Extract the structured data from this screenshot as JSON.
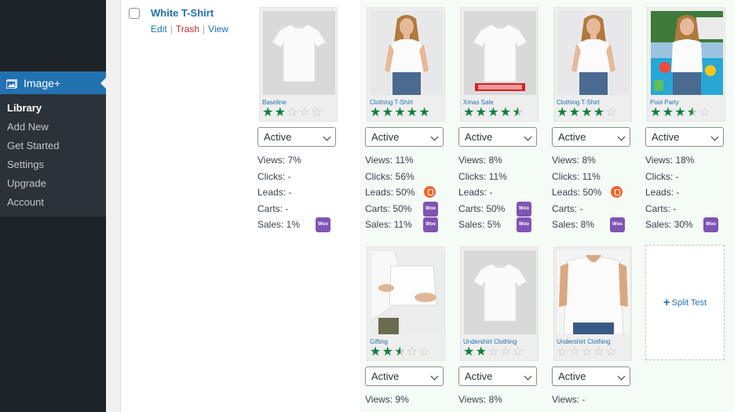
{
  "sidebar": {
    "plugin_label": "Image+",
    "items": [
      {
        "label": "Library",
        "current": true
      },
      {
        "label": "Add New",
        "current": false
      },
      {
        "label": "Get Started",
        "current": false
      },
      {
        "label": "Settings",
        "current": false
      },
      {
        "label": "Upgrade",
        "current": false
      },
      {
        "label": "Account",
        "current": false
      }
    ]
  },
  "product": {
    "title": "White T-Shirt",
    "actions": {
      "edit": "Edit",
      "trash": "Trash",
      "view": "View",
      "separator": "|"
    }
  },
  "select_option": "Active",
  "variants": [
    {
      "name": "Baseline",
      "image": "plain-tshirt",
      "rating": 2,
      "status": "Active",
      "stats": [
        "Views: 7%",
        "Clicks: -",
        "Leads: -",
        "Carts: -",
        "Sales: 1%"
      ],
      "badges": [
        "",
        "",
        "",
        "",
        "woo"
      ]
    },
    {
      "name": "Clothing T-Shirt",
      "image": "woman-model",
      "rating": 5,
      "status": "Active",
      "stats": [
        "Views: 11%",
        "Clicks: 56%",
        "Leads: 50%",
        "Carts: 50%",
        "Sales: 11%"
      ],
      "badges": [
        "",
        "",
        "convertkit",
        "woo",
        "woo"
      ]
    },
    {
      "name": "Xmas Sale",
      "image": "xmas-tshirt",
      "rating": 4.5,
      "status": "Active",
      "stats": [
        "Views: 8%",
        "Clicks: 11%",
        "Leads: -",
        "Carts: 50%",
        "Sales: 5%"
      ],
      "badges": [
        "",
        "",
        "",
        "woo",
        "woo"
      ]
    },
    {
      "name": "Clothing T-Shirt",
      "image": "woman-model",
      "rating": 4,
      "status": "Active",
      "stats": [
        "Views: 8%",
        "Clicks: 11%",
        "Leads: 50%",
        "Carts: -",
        "Sales: 8%"
      ],
      "badges": [
        "",
        "",
        "convertkit",
        "",
        "woo"
      ]
    },
    {
      "name": "Pool Party",
      "image": "pool-model",
      "rating": 3.5,
      "status": "Active",
      "stats": [
        "Views: 18%",
        "Clicks: -",
        "Leads: -",
        "Carts: -",
        "Sales: 30%"
      ],
      "badges": [
        "",
        "",
        "",
        "",
        "woo"
      ]
    },
    {
      "name": "Gifting",
      "image": "gifting",
      "rating": 2.5,
      "status": "Active",
      "stats": [
        "Views: 9%"
      ],
      "badges": [
        ""
      ]
    },
    {
      "name": "Undershirt Clothing",
      "image": "plain-tshirt",
      "rating": 2,
      "status": "Active",
      "stats": [
        "Views: 8%"
      ],
      "badges": [
        ""
      ]
    },
    {
      "name": "Undershirt Clothing",
      "image": "man-torso",
      "rating": 0,
      "status": "Active",
      "stats": [
        "Views: -"
      ],
      "badges": [
        ""
      ]
    }
  ],
  "split_test_label": "Split Test",
  "badge_woo_text": "Woo",
  "colors": {
    "star": "#108040",
    "link": "#2271b1",
    "woo": "#7f54b3",
    "convertkit": "#f0652a",
    "menu_active": "#2271b1"
  }
}
